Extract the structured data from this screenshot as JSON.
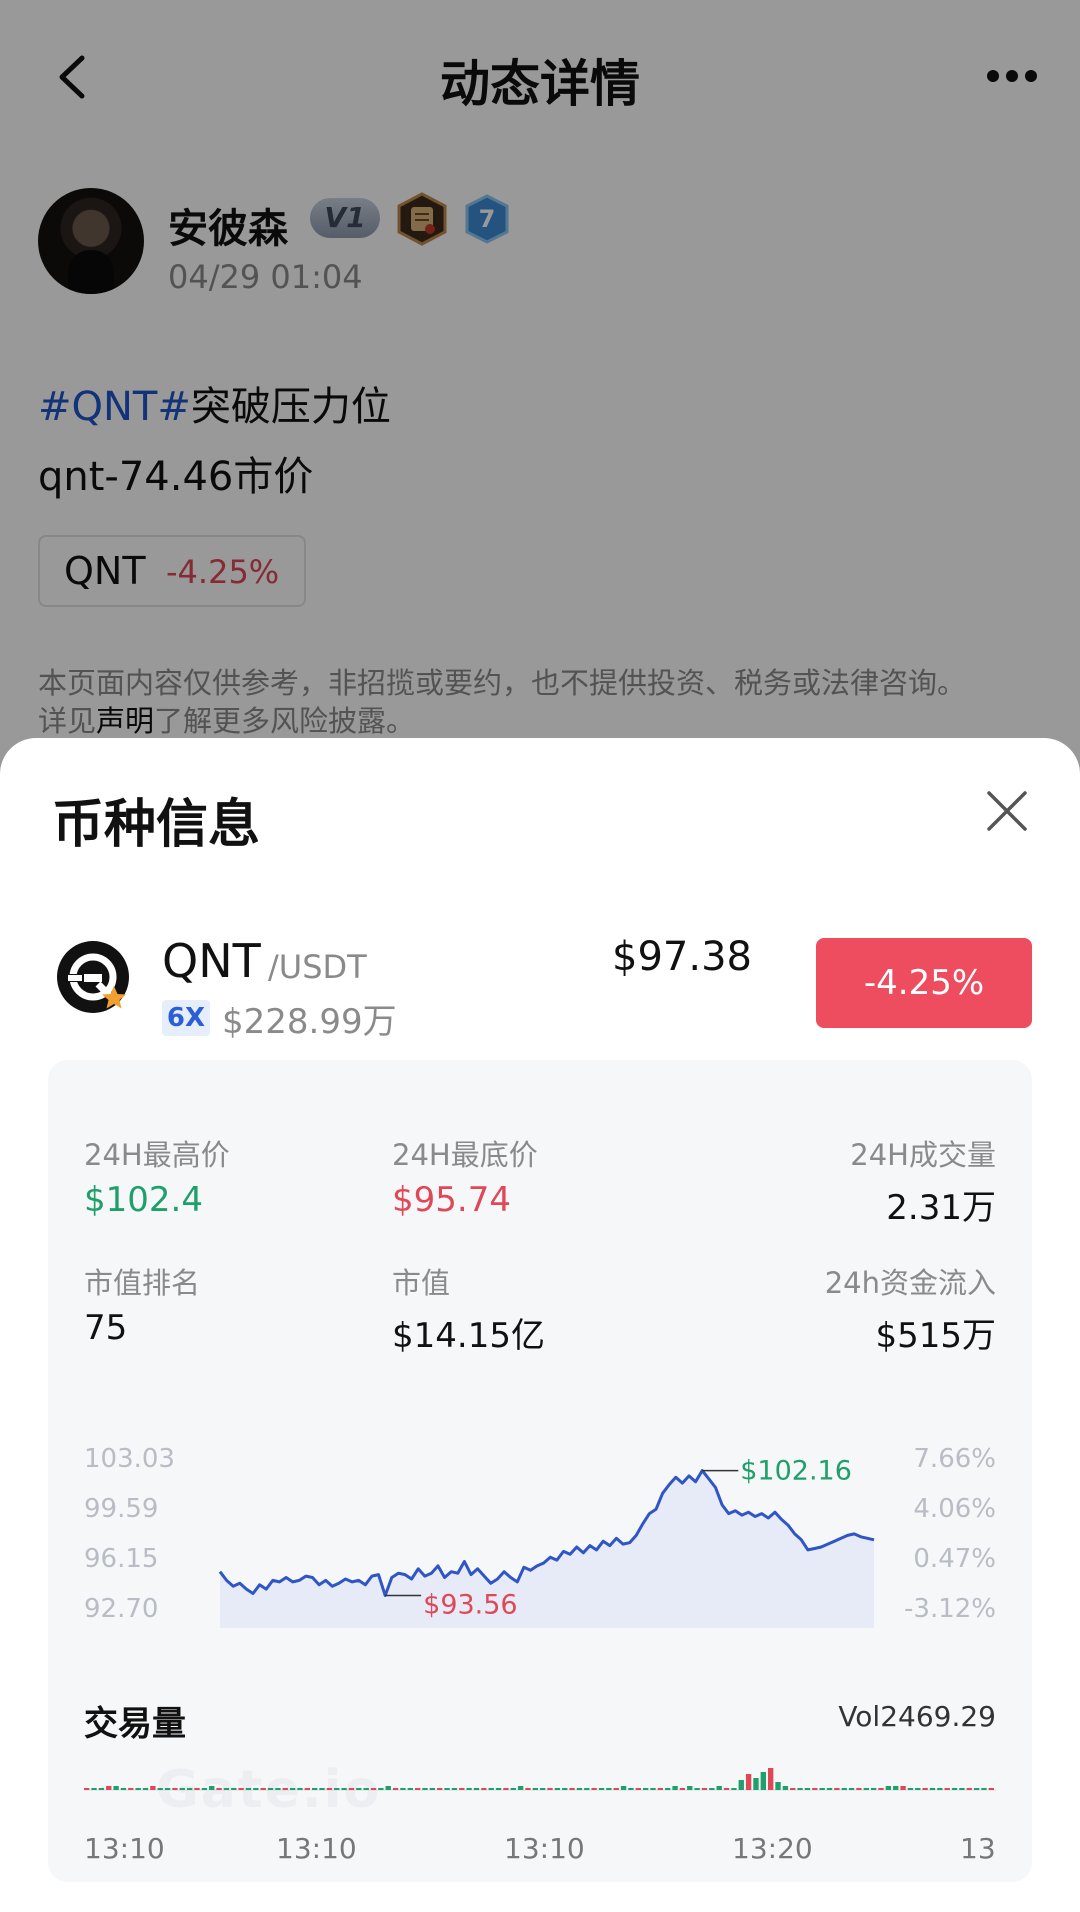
{
  "header": {
    "title": "动态详情"
  },
  "post": {
    "author": "安彼森",
    "badge_level": "V1",
    "badge_number": "7",
    "time": "04/29 01:04",
    "hashtag": "#QNT#",
    "line1_rest": "突破压力位",
    "line2": "qnt-74.46市价",
    "chip_symbol": "QNT",
    "chip_change": "-4.25%",
    "disclaimer_line1": "本页面内容仅供参考，非招揽或要约，也不提供投资、税务或法律咨询。",
    "disclaimer_pre": "详见",
    "disclaimer_link": "声明",
    "disclaimer_post": "了解更多风险披露。"
  },
  "sheet": {
    "title": "币种信息",
    "coin": {
      "symbol": "QNT",
      "quote": "/USDT",
      "leverage": "6X",
      "turnover": "$228.99万",
      "price": "$97.38",
      "change": "-4.25%"
    },
    "stats": {
      "high_label": "24H最高价",
      "high_value": "$102.4",
      "low_label": "24H最底价",
      "low_value": "$95.74",
      "volume_label": "24H成交量",
      "volume_value": "2.31万",
      "rank_label": "市值排名",
      "rank_value": "75",
      "mcap_label": "市值",
      "mcap_value": "$14.15亿",
      "inflow_label": "24h资金流入",
      "inflow_value": "$515万"
    },
    "volume_title": "交易量",
    "volume_total": "Vol2469.29",
    "time_labels": [
      "13:10",
      "13:10",
      "13:10",
      "13:20",
      "13:"
    ],
    "watermark": "Gate.io"
  },
  "chart_data": {
    "type": "line",
    "y_ticks": [
      "103.03",
      "99.59",
      "96.15",
      "92.70"
    ],
    "y_ticks_right": [
      "7.66%",
      "4.06%",
      "0.47%",
      "-3.12%"
    ],
    "ylim": [
      92.7,
      103.03
    ],
    "peak_label": "$102.16",
    "low_label": "$93.56",
    "series": [
      {
        "values": [
          95.2,
          94.6,
          94.2,
          94.4,
          94.0,
          93.7,
          94.3,
          94.0,
          94.6,
          94.5,
          94.8,
          94.5,
          94.6,
          94.9,
          94.8,
          94.3,
          94.6,
          94.2,
          94.4,
          94.7,
          94.5,
          94.6,
          94.3,
          94.9,
          95.0,
          93.56,
          94.8,
          95.1,
          95.0,
          94.7,
          95.4,
          94.9,
          95.1,
          95.6,
          94.8,
          95.2,
          95.1,
          95.9,
          95.0,
          95.4,
          94.9,
          94.4,
          94.7,
          95.2,
          94.8,
          94.5,
          95.5,
          95.3,
          95.6,
          95.8,
          96.2,
          96.0,
          96.6,
          96.4,
          96.9,
          96.5,
          97.0,
          96.7,
          97.3,
          97.0,
          97.5,
          97.1,
          97.2,
          97.7,
          98.5,
          99.2,
          99.5,
          100.6,
          101.2,
          101.7,
          101.3,
          101.8,
          101.4,
          102.16,
          101.6,
          101.0,
          99.8,
          99.2,
          99.4,
          99.1,
          99.3,
          99.0,
          99.2,
          98.9,
          99.3,
          98.8,
          98.4,
          97.8,
          97.4,
          96.7,
          96.8,
          96.9,
          97.1,
          97.3,
          97.5,
          97.7,
          97.8,
          97.6,
          97.5,
          97.4
        ]
      }
    ]
  },
  "volume_data": {
    "series": [
      {
        "values": [
          1,
          1,
          1,
          2,
          2,
          1,
          1,
          1,
          1,
          2,
          1,
          1,
          1,
          1,
          1,
          1,
          1,
          2,
          1,
          1,
          1,
          1,
          1,
          1,
          1,
          1,
          1,
          1,
          1,
          1,
          1,
          1,
          1,
          1,
          1,
          1,
          1,
          1,
          1,
          1,
          1,
          2,
          1,
          1,
          1,
          1,
          1,
          1,
          1,
          1,
          1,
          1,
          1,
          1,
          1,
          1,
          1,
          1,
          1,
          2,
          1,
          1,
          1,
          1,
          1,
          1,
          1,
          1,
          1,
          1,
          1,
          1,
          1,
          2,
          1,
          1,
          1,
          1,
          1,
          1,
          2,
          1,
          2,
          1,
          1,
          1,
          2,
          1,
          1,
          5,
          8,
          6,
          9,
          11,
          4,
          2,
          1,
          1,
          1,
          1,
          1,
          1,
          1,
          1,
          1,
          1,
          1,
          1,
          1,
          2,
          2,
          2,
          1,
          1,
          1,
          1,
          1,
          1,
          1,
          1,
          1,
          1,
          1,
          1
        ]
      }
    ]
  }
}
